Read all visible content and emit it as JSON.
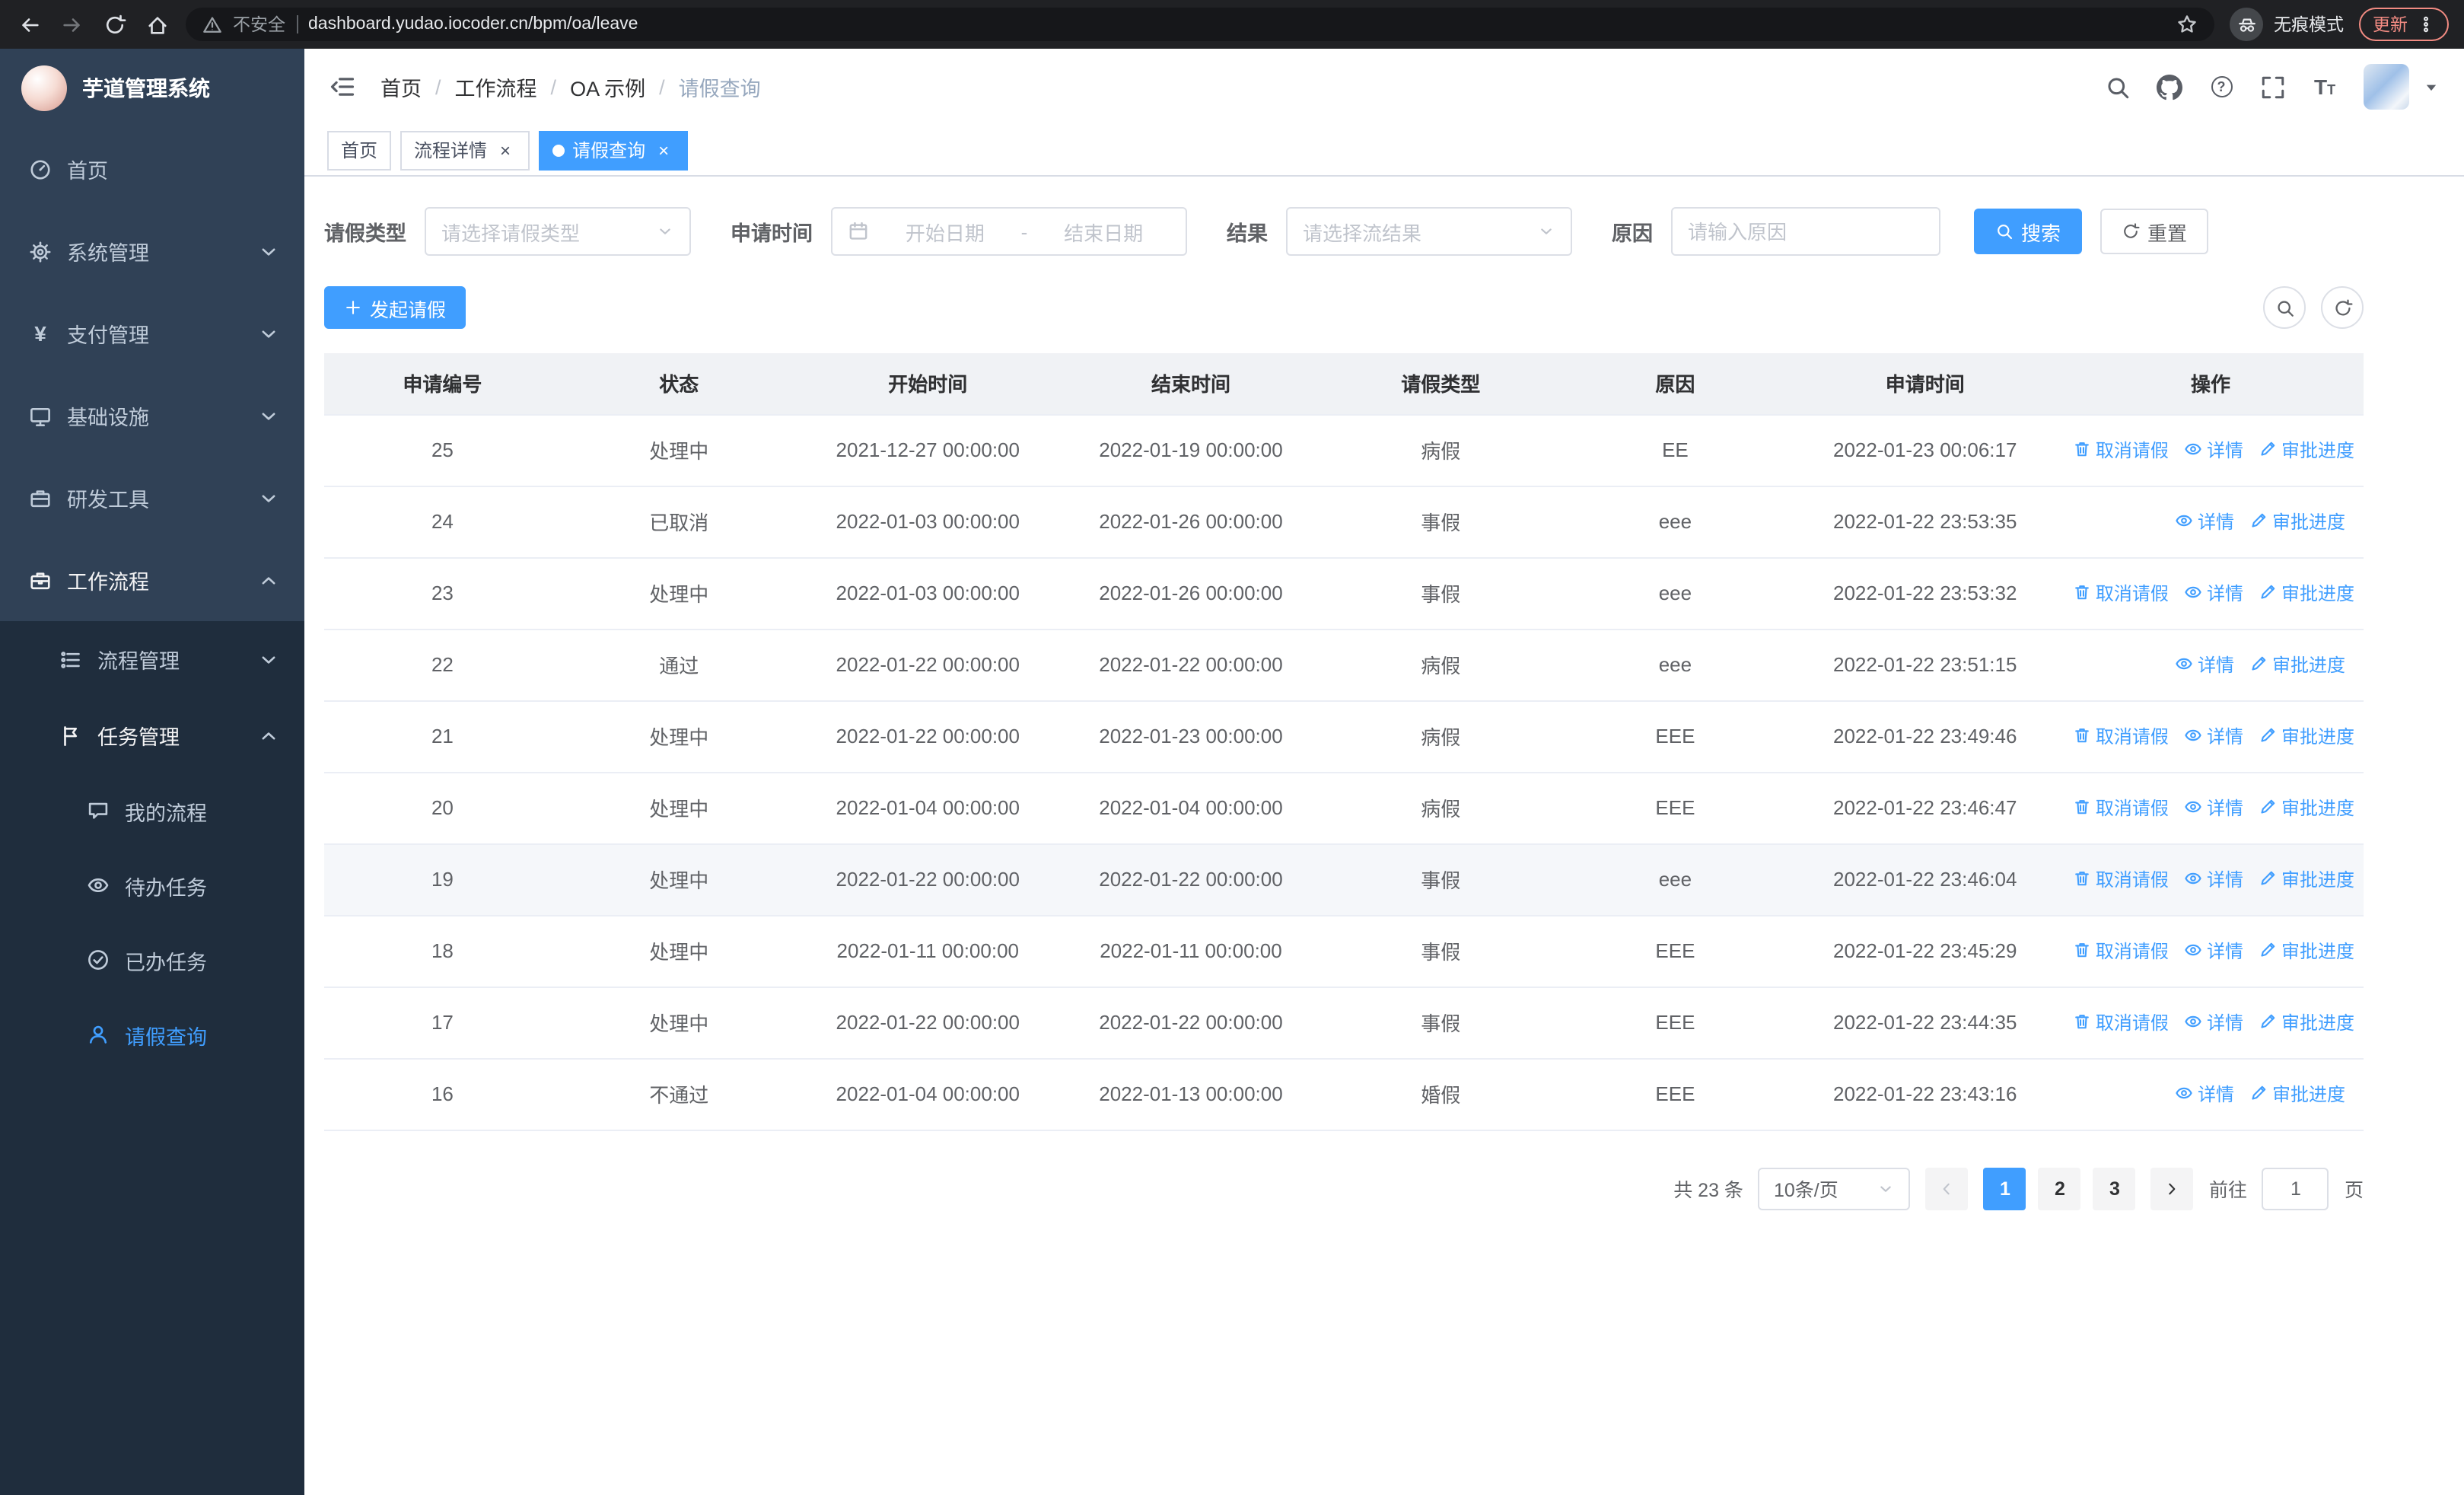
{
  "browser": {
    "security_warning": "不安全",
    "url": "dashboard.yudao.iocoder.cn/bpm/oa/leave",
    "incognito_label": "无痕模式",
    "update_label": "更新"
  },
  "sidebar": {
    "title": "芋道管理系统",
    "menu": [
      {
        "label": "首页",
        "icon": "dashboard",
        "level": 1
      },
      {
        "label": "系统管理",
        "icon": "gear",
        "level": 1,
        "arrow": "down"
      },
      {
        "label": "支付管理",
        "icon": "yen",
        "level": 1,
        "arrow": "down"
      },
      {
        "label": "基础设施",
        "icon": "monitor",
        "level": 1,
        "arrow": "down"
      },
      {
        "label": "研发工具",
        "icon": "toolbox",
        "level": 1,
        "arrow": "down"
      },
      {
        "label": "工作流程",
        "icon": "briefcase",
        "level": 1,
        "arrow": "up",
        "open": true
      },
      {
        "label": "流程管理",
        "icon": "list",
        "level": 2,
        "arrow": "down"
      },
      {
        "label": "任务管理",
        "icon": "flag",
        "level": 2,
        "arrow": "up",
        "open": true
      },
      {
        "label": "我的流程",
        "icon": "chat",
        "level": 3
      },
      {
        "label": "待办任务",
        "icon": "eye",
        "level": 3
      },
      {
        "label": "已办任务",
        "icon": "check",
        "level": 3
      },
      {
        "label": "请假查询",
        "icon": "user",
        "level": 3,
        "active": true
      }
    ]
  },
  "header": {
    "breadcrumb": [
      "首页",
      "工作流程",
      "OA 示例",
      "请假查询"
    ]
  },
  "tabs": [
    {
      "label": "首页",
      "closable": false,
      "active": false
    },
    {
      "label": "流程详情",
      "closable": true,
      "active": false
    },
    {
      "label": "请假查询",
      "closable": true,
      "active": true
    }
  ],
  "filters": {
    "leave_type": {
      "label": "请假类型",
      "placeholder": "请选择请假类型"
    },
    "apply_time": {
      "label": "申请时间",
      "start_placeholder": "开始日期",
      "separator": "-",
      "end_placeholder": "结束日期"
    },
    "result": {
      "label": "结果",
      "placeholder": "请选择流结果"
    },
    "reason": {
      "label": "原因",
      "placeholder": "请输入原因"
    },
    "search_label": "搜索",
    "reset_label": "重置"
  },
  "toolbar": {
    "create_label": "发起请假"
  },
  "table": {
    "columns": [
      "申请编号",
      "状态",
      "开始时间",
      "结束时间",
      "请假类型",
      "原因",
      "申请时间",
      "操作"
    ],
    "action_labels": {
      "cancel": "取消请假",
      "detail": "详情",
      "progress": "审批进度"
    },
    "rows": [
      {
        "id": "25",
        "status": "处理中",
        "start": "2021-12-27 00:00:00",
        "end": "2022-01-19 00:00:00",
        "type": "病假",
        "reason": "EE",
        "apply": "2022-01-23 00:06:17",
        "actions": [
          "cancel",
          "detail",
          "progress"
        ]
      },
      {
        "id": "24",
        "status": "已取消",
        "start": "2022-01-03 00:00:00",
        "end": "2022-01-26 00:00:00",
        "type": "事假",
        "reason": "eee",
        "apply": "2022-01-22 23:53:35",
        "actions": [
          "detail",
          "progress"
        ]
      },
      {
        "id": "23",
        "status": "处理中",
        "start": "2022-01-03 00:00:00",
        "end": "2022-01-26 00:00:00",
        "type": "事假",
        "reason": "eee",
        "apply": "2022-01-22 23:53:32",
        "actions": [
          "cancel",
          "detail",
          "progress"
        ]
      },
      {
        "id": "22",
        "status": "通过",
        "start": "2022-01-22 00:00:00",
        "end": "2022-01-22 00:00:00",
        "type": "病假",
        "reason": "eee",
        "apply": "2022-01-22 23:51:15",
        "actions": [
          "detail",
          "progress"
        ]
      },
      {
        "id": "21",
        "status": "处理中",
        "start": "2022-01-22 00:00:00",
        "end": "2022-01-23 00:00:00",
        "type": "病假",
        "reason": "EEE",
        "apply": "2022-01-22 23:49:46",
        "actions": [
          "cancel",
          "detail",
          "progress"
        ]
      },
      {
        "id": "20",
        "status": "处理中",
        "start": "2022-01-04 00:00:00",
        "end": "2022-01-04 00:00:00",
        "type": "病假",
        "reason": "EEE",
        "apply": "2022-01-22 23:46:47",
        "actions": [
          "cancel",
          "detail",
          "progress"
        ]
      },
      {
        "id": "19",
        "status": "处理中",
        "start": "2022-01-22 00:00:00",
        "end": "2022-01-22 00:00:00",
        "type": "事假",
        "reason": "eee",
        "apply": "2022-01-22 23:46:04",
        "actions": [
          "cancel",
          "detail",
          "progress"
        ],
        "hover": true
      },
      {
        "id": "18",
        "status": "处理中",
        "start": "2022-01-11 00:00:00",
        "end": "2022-01-11 00:00:00",
        "type": "事假",
        "reason": "EEE",
        "apply": "2022-01-22 23:45:29",
        "actions": [
          "cancel",
          "detail",
          "progress"
        ]
      },
      {
        "id": "17",
        "status": "处理中",
        "start": "2022-01-22 00:00:00",
        "end": "2022-01-22 00:00:00",
        "type": "事假",
        "reason": "EEE",
        "apply": "2022-01-22 23:44:35",
        "actions": [
          "cancel",
          "detail",
          "progress"
        ]
      },
      {
        "id": "16",
        "status": "不通过",
        "start": "2022-01-04 00:00:00",
        "end": "2022-01-13 00:00:00",
        "type": "婚假",
        "reason": "EEE",
        "apply": "2022-01-22 23:43:16",
        "actions": [
          "detail",
          "progress"
        ]
      }
    ]
  },
  "pagination": {
    "total": "共 23 条",
    "page_size": "10条/页",
    "pages": [
      "1",
      "2",
      "3"
    ],
    "active_page": "1",
    "goto_prefix": "前往",
    "goto_value": "1",
    "goto_suffix": "页"
  },
  "colors": {
    "accent": "#409EFF",
    "sidebar_bg": "#304156",
    "sidebar_sub_bg": "#1f2d3d",
    "update_red": "#f28b82"
  }
}
